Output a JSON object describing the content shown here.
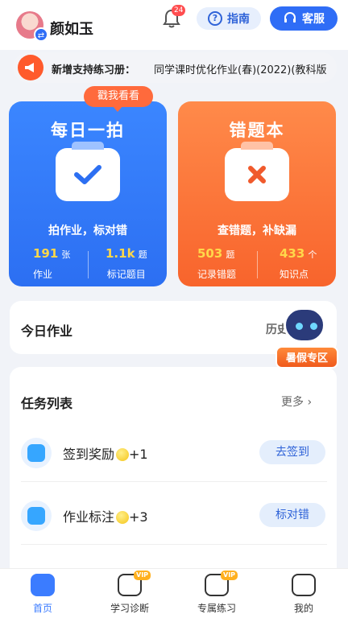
{
  "header": {
    "username": "颜如玉",
    "notification_count": "24",
    "guide_label": "指南",
    "service_label": "客服"
  },
  "notice": {
    "label": "新增支持练习册：",
    "text": "同学课时优化作业(春)(2022)(教科版"
  },
  "card_photo": {
    "bubble": "戳我看看",
    "title": "每日一拍",
    "slogan": "拍作业，标对错",
    "stats": [
      {
        "num": "191",
        "unit": "张",
        "caption": "作业"
      },
      {
        "num": "1.1k",
        "unit": "题",
        "caption": "标记题目"
      }
    ]
  },
  "card_mistakes": {
    "title": "错题本",
    "slogan": "查错题，补缺漏",
    "stats": [
      {
        "num": "503",
        "unit": "题",
        "caption": "记录错题"
      },
      {
        "num": "433",
        "unit": "个",
        "caption": "知识点"
      }
    ]
  },
  "today": {
    "title": "今日作业",
    "history": "历史"
  },
  "mascot": {
    "banner": "暑假专区"
  },
  "tasks": {
    "title": "任务列表",
    "more": "更多",
    "items": [
      {
        "name": "签到奖励",
        "reward": "+1",
        "action": "去签到"
      },
      {
        "name": "作业标注",
        "reward": "+3",
        "action": "标对错"
      }
    ]
  },
  "tabbar": {
    "items": [
      {
        "label": "首页"
      },
      {
        "label": "学习诊断",
        "badge": "VIP"
      },
      {
        "label": "专属练习",
        "badge": "VIP"
      },
      {
        "label": "我的"
      }
    ]
  },
  "colors": {
    "primary": "#2f6df6",
    "orange": "#f8642c",
    "stat_highlight": "#ffd84a"
  }
}
